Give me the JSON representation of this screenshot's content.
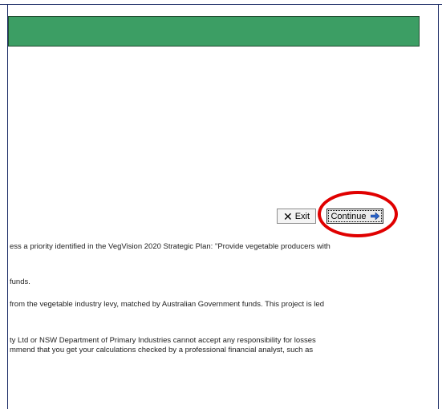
{
  "buttons": {
    "exit_label": "Exit",
    "continue_label": "Continue"
  },
  "body_text": {
    "line_1": "ess a priority identified in the VegVision 2020 Strategic Plan:  \"Provide vegetable producers with",
    "line_2": " funds.",
    "line_3": "from the vegetable industry levy, matched by Australian Government funds. This project is led",
    "line_4": "ty Ltd or NSW Department of Primary Industries cannot accept any responsibility for losses",
    "line_5": "mmend that you get your calculations checked by a professional financial analyst, such as"
  },
  "colors": {
    "header_bar": "#3c9e64",
    "frame_rule": "#1c2c66",
    "highlight_ring": "#e00000",
    "continue_arrow": "#2a63c8"
  },
  "icons": {
    "exit": "close-x-icon",
    "continue": "arrow-right-icon"
  }
}
